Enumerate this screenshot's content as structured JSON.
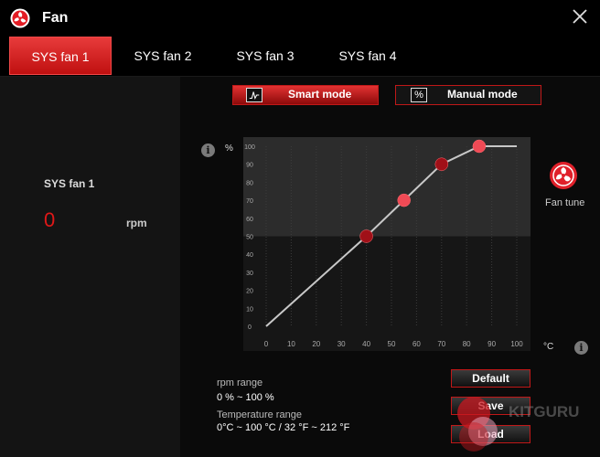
{
  "window": {
    "title": "Fan",
    "close_icon": "close-icon",
    "logo_icon": "msi-dragon-logo-icon"
  },
  "tabs": [
    {
      "label": "SYS fan 1",
      "active": true
    },
    {
      "label": "SYS fan 2",
      "active": false
    },
    {
      "label": "SYS fan 3",
      "active": false
    },
    {
      "label": "SYS fan 4",
      "active": false
    }
  ],
  "fan_status": {
    "name": "SYS fan 1",
    "rpm": "0",
    "unit": "rpm"
  },
  "modes": {
    "smart": {
      "label": "Smart mode",
      "icon": "curve-icon",
      "active": true
    },
    "manual": {
      "label": "Manual mode",
      "icon_glyph": "%",
      "active": false
    }
  },
  "chart_data": {
    "type": "line",
    "ylabel": "%",
    "xlabel": "°C",
    "x_ticks": [
      0,
      10,
      20,
      30,
      40,
      50,
      60,
      70,
      80,
      90,
      100
    ],
    "y_ticks": [
      0,
      10,
      20,
      30,
      40,
      50,
      60,
      70,
      80,
      90,
      100
    ],
    "xlim": [
      0,
      100
    ],
    "ylim": [
      0,
      100
    ],
    "grid": true,
    "series": [
      {
        "points": [
          [
            0,
            0
          ],
          [
            40,
            50
          ],
          [
            55,
            70
          ],
          [
            70,
            90
          ],
          [
            85,
            100
          ],
          [
            100,
            100
          ]
        ]
      }
    ],
    "control_points": [
      [
        40,
        50
      ],
      [
        55,
        70
      ],
      [
        70,
        90
      ],
      [
        85,
        100
      ]
    ],
    "colors": {
      "line": "#c8c8c8",
      "point_dark": "#a01018",
      "point_light": "#f04a55"
    }
  },
  "fan_tune": {
    "label": "Fan tune",
    "icon": "fan-tune-icon",
    "color": "#e0202a"
  },
  "ranges": {
    "rpm_label": "rpm range",
    "rpm_value": "0 % ~ 100 %",
    "temp_label": "Temperature range",
    "temp_value": "0°C ~ 100 °C / 32 °F ~ 212 °F"
  },
  "buttons": {
    "default": "Default",
    "save": "Save",
    "load": "Load"
  },
  "watermark": "KITGURU"
}
